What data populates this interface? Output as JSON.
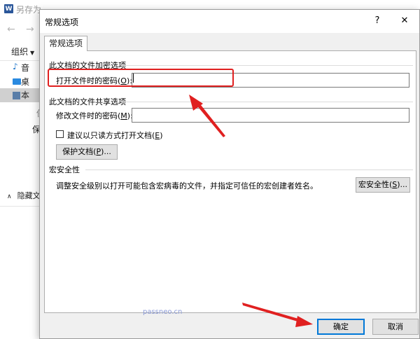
{
  "background_window": {
    "app_icon_letter": "W",
    "title": "另存为",
    "back_arrow": "←",
    "forward_arrow": "→",
    "organize_label": "组织",
    "nav_items": [
      {
        "icon": "music-note-icon",
        "label": "音"
      },
      {
        "icon": "desktop-icon",
        "label": "桌"
      },
      {
        "icon": "this-pc-icon",
        "label": "本"
      }
    ],
    "fragments": [
      "保",
      "保"
    ],
    "hide_folders_label": "隐藏文件"
  },
  "dialog": {
    "title": "常规选项",
    "help_glyph": "?",
    "close_glyph": "✕",
    "tab_label": "常规选项",
    "encryption_group": {
      "title": "此文档的文件加密选项",
      "open_password_label_pre": "打开文件时的密码(",
      "open_password_key": "O",
      "open_password_label_post": "):",
      "open_password_value": ""
    },
    "sharing_group": {
      "title": "此文档的文件共享选项",
      "modify_password_label_pre": "修改文件时的密码(",
      "modify_password_key": "M",
      "modify_password_label_post": "):",
      "modify_password_value": "",
      "readonly_label_pre": "建议以只读方式打开文档(",
      "readonly_key": "E",
      "readonly_label_post": ")",
      "readonly_checked": false,
      "protect_button_pre": "保护文档(",
      "protect_button_key": "P",
      "protect_button_post": ")..."
    },
    "macro_group": {
      "title": "宏安全性",
      "description": "调整安全级别以打开可能包含宏病毒的文件，并指定可信任的宏创建者姓名。",
      "button_pre": "宏安全性(",
      "button_key": "S",
      "button_post": ")..."
    },
    "ok_label": "确定",
    "cancel_label": "取消"
  },
  "watermark": "passneo.cn",
  "annotation_color": "#e02020"
}
